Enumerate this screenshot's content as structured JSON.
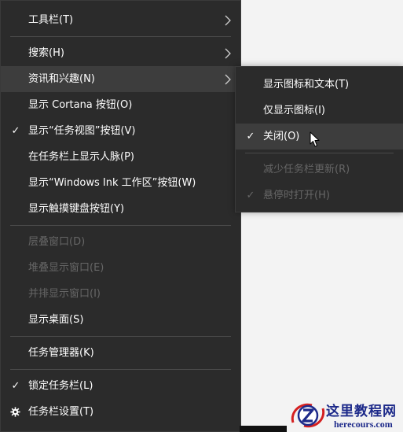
{
  "main_menu": {
    "items": [
      {
        "label": "工具栏(T)"
      },
      {
        "label": "搜索(H)"
      },
      {
        "label": "资讯和兴趣(N)"
      },
      {
        "label": "显示 Cortana 按钮(O)"
      },
      {
        "label": "显示“任务视图”按钮(V)"
      },
      {
        "label": "在任务栏上显示人脉(P)"
      },
      {
        "label": "显示“Windows Ink 工作区”按钮(W)"
      },
      {
        "label": "显示触摸键盘按钮(Y)"
      },
      {
        "label": "层叠窗口(D)"
      },
      {
        "label": "堆叠显示窗口(E)"
      },
      {
        "label": "并排显示窗口(I)"
      },
      {
        "label": "显示桌面(S)"
      },
      {
        "label": "任务管理器(K)"
      },
      {
        "label": "锁定任务栏(L)"
      },
      {
        "label": "任务栏设置(T)"
      }
    ]
  },
  "submenu": {
    "items": [
      {
        "label": "显示图标和文本(T)"
      },
      {
        "label": "仅显示图标(I)"
      },
      {
        "label": "关闭(O)"
      },
      {
        "label": "减少任务栏更新(R)"
      },
      {
        "label": "悬停时打开(H)"
      }
    ]
  },
  "glyphs": {
    "check": "✓"
  },
  "icons": {
    "submenu_arrow": "chevron-right-icon",
    "checkmark": "checkmark-icon",
    "settings": "gear-icon",
    "pointer": "mouse-pointer-icon"
  },
  "watermark": {
    "title": "这里教程网",
    "url": "herecours.com"
  },
  "colors": {
    "menu_bg": "#2b2b2b",
    "highlight_bg": "#3d3d3d",
    "text": "#ffffff",
    "disabled_text": "#666666",
    "separator": "#4a4a4a",
    "watermark": "#1d2a8a",
    "watermark_accent": "#d42020"
  }
}
